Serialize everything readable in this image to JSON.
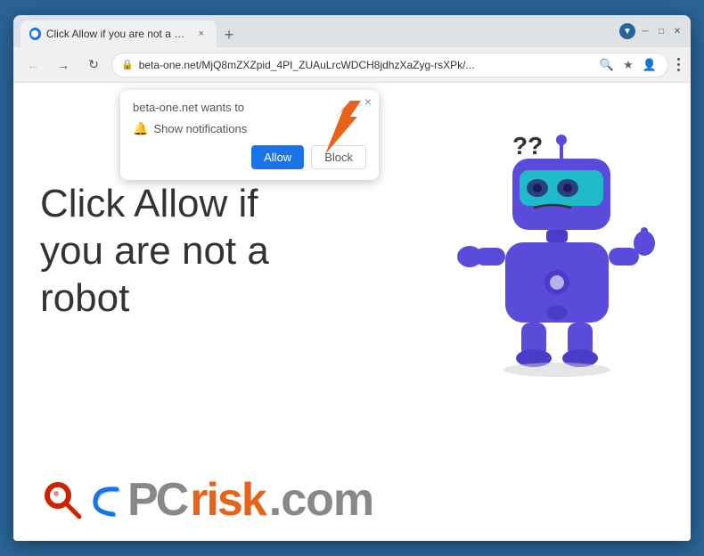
{
  "window": {
    "title": "Click Allow if you are not a robot",
    "url": "beta-one.net/MjQ8mZXZpid_4PI_ZUAuLrcWDCH8jdhzXaZyg-rsXPk/...",
    "new_tab_label": "+",
    "tab_close": "×"
  },
  "nav": {
    "back_label": "←",
    "forward_label": "→",
    "refresh_label": "↻",
    "lock_label": "🔒"
  },
  "notification_popup": {
    "title": "beta-one.net wants to",
    "show_notifications": "Show notifications",
    "allow_label": "Allow",
    "block_label": "Block",
    "close_label": "×"
  },
  "page": {
    "main_text": "Click Allow if\nyou are not a\nrobot"
  },
  "footer": {
    "pc_text": "PC",
    "risk_text": "risk",
    "com_text": ".com"
  },
  "colors": {
    "accent_blue": "#1a73e8",
    "orange": "#e8621a",
    "robot_body": "#5b4bdb",
    "robot_head": "#4a3cc7"
  }
}
